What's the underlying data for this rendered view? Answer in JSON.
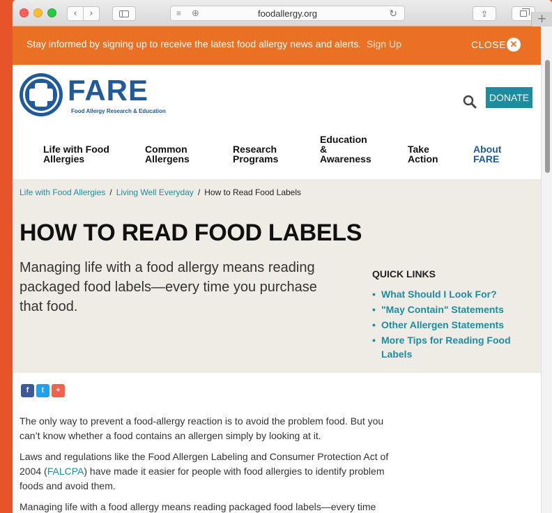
{
  "browser": {
    "url": "foodallergy.org",
    "back_glyph": "‹",
    "forward_glyph": "›",
    "new_tab_glyph": "+"
  },
  "alert": {
    "message": "Stay informed by signing up to receive the latest food allergy news and alerts.",
    "signup_label": "Sign Up",
    "close_label": "CLOSE",
    "close_glyph": "✕"
  },
  "header": {
    "logo_word": "FARE",
    "logo_subtitle": "Food Allergy Research & Education",
    "donate_label": "DONATE"
  },
  "nav": {
    "items": [
      {
        "line1": "Life with Food",
        "line2": "Allergies"
      },
      {
        "line1": "Common",
        "line2": "Allergens"
      },
      {
        "line1": "Research",
        "line2": "Programs"
      },
      {
        "line1": "Education",
        "line2": "&",
        "line3": "Awareness"
      },
      {
        "line1": "Take",
        "line2": "Action"
      },
      {
        "line1": "About",
        "line2": "FARE"
      }
    ]
  },
  "breadcrumb": {
    "items": [
      "Life with Food Allergies",
      "Living Well Everyday",
      "How to Read Food Labels"
    ],
    "separator": "/"
  },
  "hero": {
    "title": "HOW TO READ FOOD LABELS",
    "lead": "Managing life with a food allergy means reading packaged food labels—every time you purchase that food."
  },
  "quick_links": {
    "title": "QUICK LINKS",
    "items": [
      "What Should I Look For?",
      "\"May Contain\" Statements",
      "Other Allergen Statements",
      "More Tips for Reading Food Labels"
    ]
  },
  "social": {
    "facebook": "f",
    "twitter": "t",
    "google": "+"
  },
  "body": {
    "p1": "The only way to prevent a food-allergy reaction is to avoid the problem food. But you can’t know whether a food contains an allergen simply by looking at it.",
    "p2_before": "Laws and regulations like the Food Allergen Labeling and Consumer Protection Act of 2004 (",
    "p2_link": "FALCPA",
    "p2_after": ") have made it easier for people with food allergies to identify problem foods and avoid them.",
    "p3": "Managing life with a food allergy means reading packaged food labels—every time"
  },
  "colors": {
    "brand_blue": "#1e5a9c",
    "teal_link": "#1c8da0",
    "alert_orange": "#ea7124",
    "hero_bg": "#efebe5"
  }
}
